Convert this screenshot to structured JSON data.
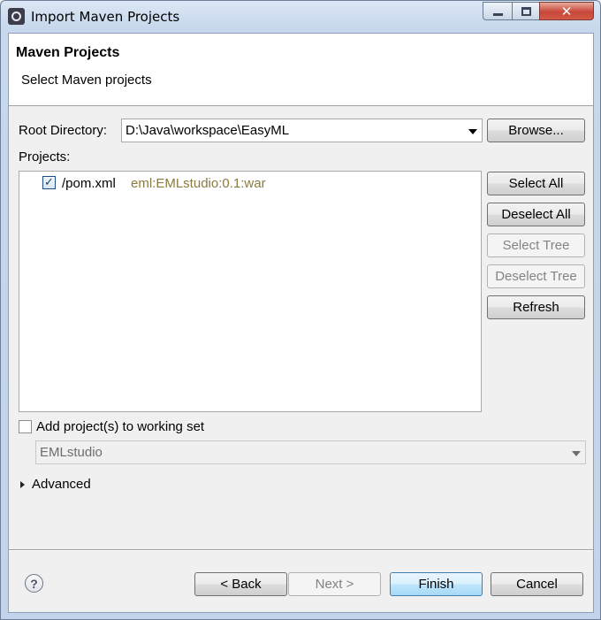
{
  "window": {
    "title": "Import Maven Projects",
    "icon": "eclipse-icon",
    "controls": {
      "minimize": "minimize-icon",
      "maximize": "maximize-icon",
      "close": "close-icon",
      "close_glyph": "✕"
    }
  },
  "header": {
    "title": "Maven Projects",
    "subtitle": "Select Maven projects"
  },
  "root_directory": {
    "label": "Root Directory:",
    "value": "D:\\Java\\workspace\\EasyML",
    "browse_label": "Browse..."
  },
  "projects": {
    "label": "Projects:",
    "items": [
      {
        "checked": true,
        "name": "/pom.xml",
        "id": "eml:EMLstudio:0.1:war"
      }
    ],
    "buttons": {
      "select_all": "Select All",
      "deselect_all": "Deselect All",
      "select_tree": "Select Tree",
      "deselect_tree": "Deselect Tree",
      "refresh": "Refresh"
    }
  },
  "working_set": {
    "label": "Add project(s) to working set",
    "checked": false,
    "value": "EMLstudio",
    "enabled": false
  },
  "advanced": {
    "label": "Advanced",
    "expanded": false
  },
  "footer": {
    "help_glyph": "?",
    "back": "< Back",
    "next": "Next >",
    "finish": "Finish",
    "cancel": "Cancel"
  },
  "colors": {
    "artifact_id_text": "#8b7a3f",
    "default_button_border": "#3c7fb1",
    "close_button": "#c9473b"
  }
}
